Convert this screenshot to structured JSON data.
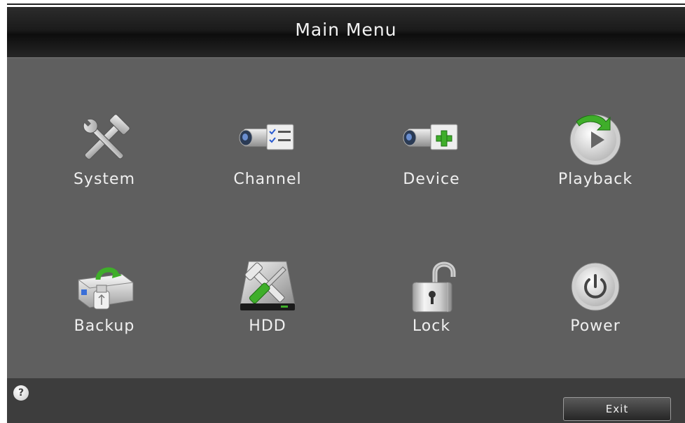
{
  "window": {
    "title": "Main Menu"
  },
  "menu": {
    "items": [
      {
        "label": "System",
        "icon": "tools-icon"
      },
      {
        "label": "Channel",
        "icon": "camera-checklist-icon"
      },
      {
        "label": "Device",
        "icon": "camera-add-icon"
      },
      {
        "label": "Playback",
        "icon": "playback-icon"
      },
      {
        "label": "Backup",
        "icon": "usb-backup-icon"
      },
      {
        "label": "HDD",
        "icon": "hdd-tools-icon"
      },
      {
        "label": "Lock",
        "icon": "padlock-icon"
      },
      {
        "label": "Power",
        "icon": "power-icon"
      }
    ]
  },
  "footer": {
    "help_label": "?",
    "exit_label": "Exit"
  },
  "colors": {
    "panel": "#5f5f5f",
    "titlebar": "#1b1b1b",
    "footer": "#3d3d3d",
    "accent_green": "#3fae2a"
  }
}
